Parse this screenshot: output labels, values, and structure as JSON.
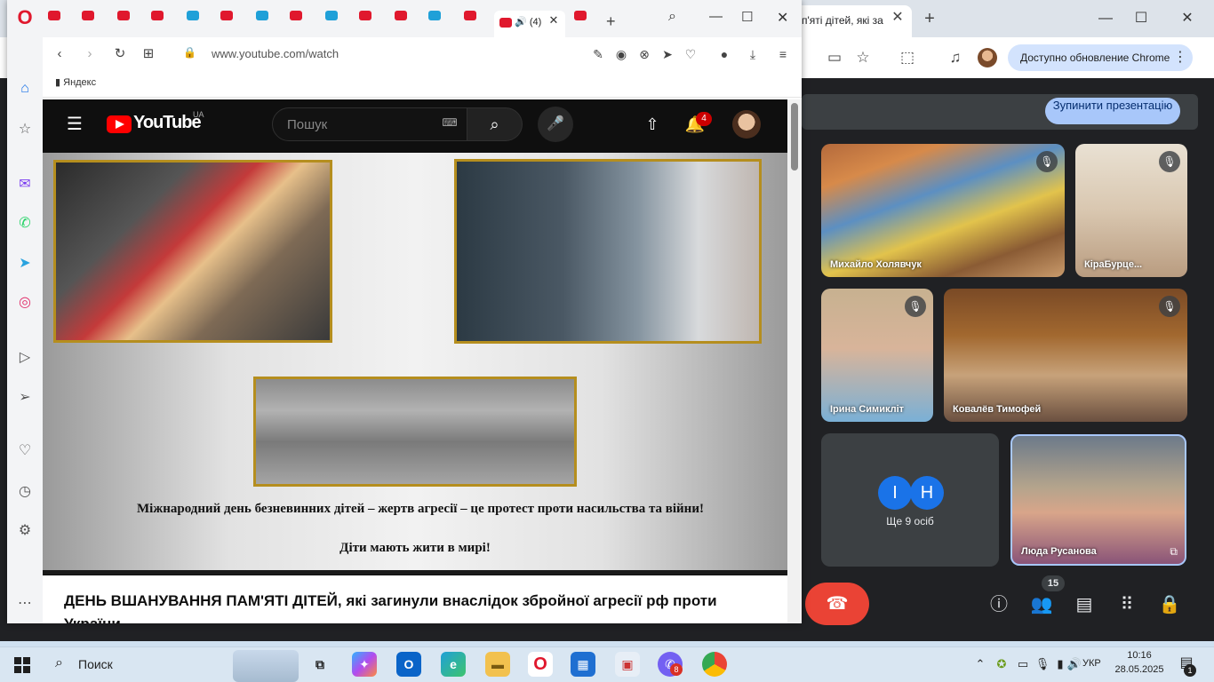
{
  "chrome": {
    "tab_title": "п'яті дітей, які за",
    "update_button": "Доступно обновление Chrome"
  },
  "meet": {
    "stop_presenting": "Зупинити презентацію",
    "participants": [
      {
        "name": "Михайло Холявчук"
      },
      {
        "name": "КіраБурце..."
      },
      {
        "name": "Ірина Симикліт"
      },
      {
        "name": "Ковалёв Тимофей"
      },
      {
        "name": "Люда Русанова"
      }
    ],
    "more_initials": [
      "І",
      "Н"
    ],
    "more_label": "Ще 9 осіб",
    "people_count": "15"
  },
  "opera": {
    "active_tab": "(4)",
    "url": "www.youtube.com/watch",
    "bookmark": "Яндекс"
  },
  "youtube": {
    "logo_text": "YouTube",
    "region": "UA",
    "search_placeholder": "Пошук",
    "notification_count": "4",
    "caption_line1": "Міжнародний день безневинних дітей – жертв агресії – це протест проти насильства та війни!",
    "caption_line2": "Діти мають жити в мирі!",
    "video_title": "ДЕНЬ ВШАНУВАННЯ ПАМ'ЯТІ ДІТЕЙ, які загинули внаслідок збройної агресії рф проти України"
  },
  "taskbar": {
    "search_label": "Поиск",
    "viber_badge": "8",
    "language": "УКР",
    "time": "10:16",
    "date": "28.05.2025",
    "notification_badge": "1"
  }
}
